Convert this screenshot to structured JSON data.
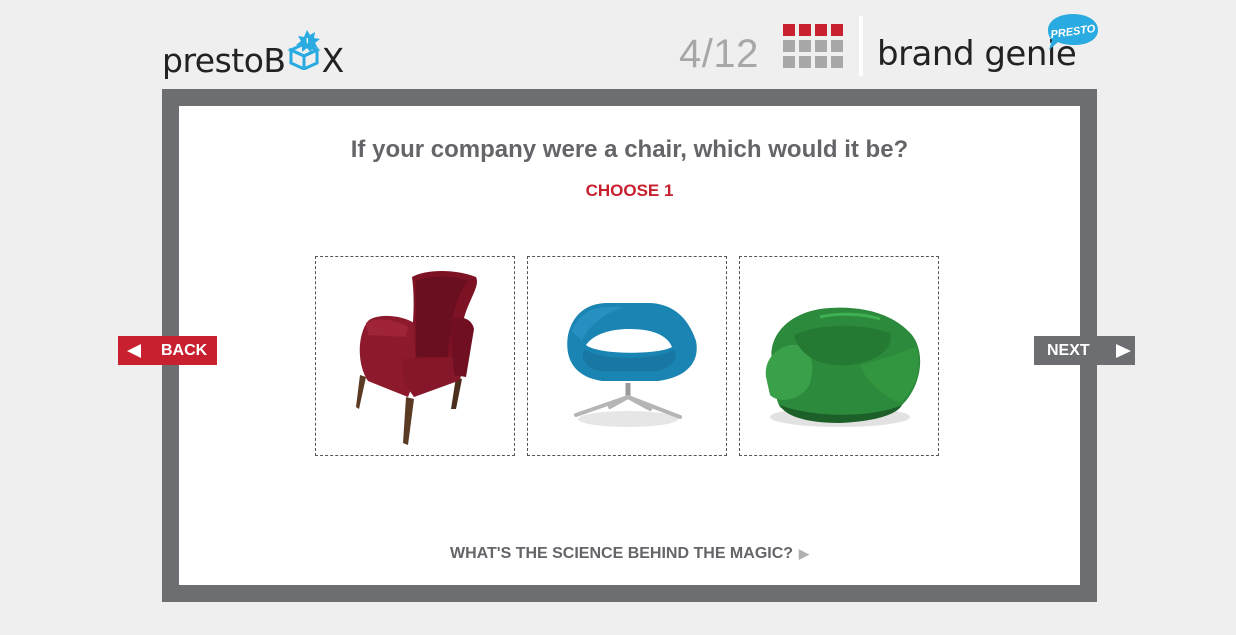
{
  "header": {
    "logo_left": {
      "before": "presto",
      "b": "B",
      "after": "X"
    },
    "progress": {
      "current": 4,
      "total": 12,
      "text": "4/12"
    },
    "logo_right": {
      "text": "brand genie",
      "badge": "PRESTO"
    },
    "colors": {
      "progress_filled": "#c8202f",
      "progress_empty": "#a7a7a7",
      "badge": "#29aae1"
    }
  },
  "question": {
    "text": "If your company were a chair, which would it be?",
    "instruction": "CHOOSE 1"
  },
  "options": [
    {
      "icon": "armchair-red-velvet-icon"
    },
    {
      "icon": "chair-blue-modern-icon"
    },
    {
      "icon": "beanbag-green-icon"
    }
  ],
  "footer_link": {
    "text": "WHAT'S THE SCIENCE BEHIND THE MAGIC?"
  },
  "nav": {
    "back": "BACK",
    "next": "NEXT"
  },
  "colors": {
    "accent": "#c8202f",
    "frame": "#6d6e71",
    "text": "#646569"
  }
}
